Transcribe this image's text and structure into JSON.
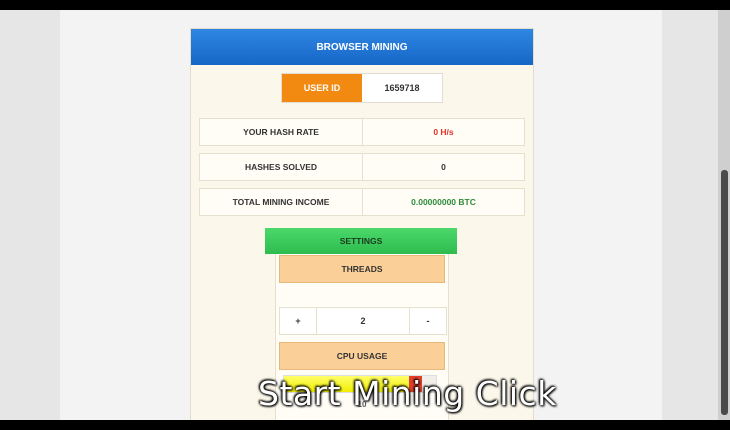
{
  "panel": {
    "title": "BROWSER MINING",
    "user_id_label": "USER ID",
    "user_id_value": "1659718"
  },
  "stats": [
    {
      "label": "YOUR HASH RATE",
      "value": "0 H/s",
      "color": "#e0342a"
    },
    {
      "label": "HASHES SOLVED",
      "value": "0",
      "color": "#333333"
    },
    {
      "label": "TOTAL MINING INCOME",
      "value": "0.00000000 BTC",
      "color": "#2e8b3a"
    }
  ],
  "settings": {
    "button_label": "SETTINGS",
    "threads_label": "THREADS",
    "threads_increment": "+",
    "threads_value": "2",
    "threads_decrement": "-",
    "cpu_label": "CPU USAGE",
    "cpu_value_text": "10"
  },
  "cpu_usage_fraction": 0.9,
  "caption": "Start Mining Click",
  "colors": {
    "header": "#1c6fd0",
    "user_id": "#f28a12",
    "settings": "#3cc85d",
    "section": "#fbcf98"
  }
}
